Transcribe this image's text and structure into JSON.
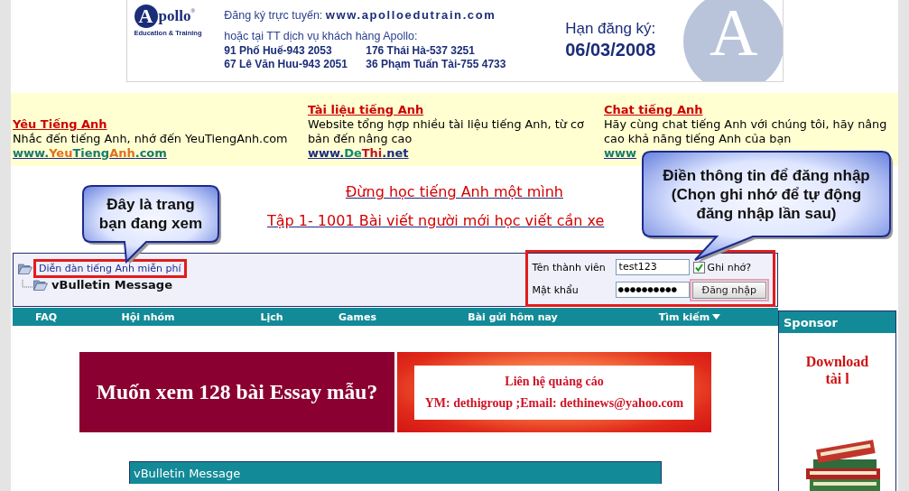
{
  "banner": {
    "logo": {
      "initial": "A",
      "name": "pollo",
      "mark": "®",
      "tagline": "Education & Training"
    },
    "register_label": "Đăng ký trực tuyến:",
    "register_url": "www.apolloedutrain.com",
    "service_line": "hoặc tại TT dịch vụ khách hàng Apollo:",
    "addresses": [
      "91 Phố Huế-943 2053",
      "176 Thái Hà-537 3251",
      "67 Lê Văn Huu-943 2051",
      "36 Phạm Tuấn Tài-755 4733"
    ],
    "deadline_label": "Hạn đăng ký:",
    "deadline_date": "06/03/2008",
    "emblem_letter": "A"
  },
  "promo_links": [
    {
      "title": "Yêu Tiếng Anh",
      "description": "Nhắc đến tiếng Anh, nhớ đến YeuTiengAnh.com",
      "url": [
        {
          "text": "www.",
          "color": "#1a7a68"
        },
        {
          "text": "Yeu",
          "color": "#e0701c"
        },
        {
          "text": "Tieng",
          "color": "#1a7a68"
        },
        {
          "text": "Anh",
          "color": "#e0701c"
        },
        {
          "text": ".com",
          "color": "#1a7a68"
        }
      ]
    },
    {
      "title": "Tài liệu tiếng Anh",
      "description": "Website tổng hợp nhiều tài liệu tiếng Anh, từ cơ bản đến nâng cao",
      "url": [
        {
          "text": "www.",
          "color": "#1c2a80"
        },
        {
          "text": "De",
          "color": "#128a6a"
        },
        {
          "text": "Thi",
          "color": "#c0142a"
        },
        {
          "text": ".net",
          "color": "#1c2a80"
        }
      ]
    },
    {
      "title": "Chat tiếng Anh",
      "description": "Hãy cùng chat tiếng Anh với chúng tôi, hãy nâng cao khả năng tiếng Anh của bạn",
      "url": [
        {
          "text": "www",
          "color": "#1a7a68"
        }
      ]
    }
  ],
  "headings": [
    "Đừng học tiếng Anh một mình",
    "Tập 1- 1001 Bài viết người mới học viết cần xe"
  ],
  "callouts": [
    {
      "lines": [
        "Đây là trang",
        "bạn đang xem"
      ]
    },
    {
      "lines": [
        "Điền thông tin để đăng nhập",
        "(Chọn ghi nhớ để tự động",
        "đăng nhập lần sau)"
      ]
    }
  ],
  "breadcrumb": {
    "parent": "Diễn đàn tiếng Anh miễn phí",
    "highlighted": true,
    "current": "vBulletin Message"
  },
  "login": {
    "highlighted": true,
    "username_label": "Tên thành viên",
    "username": "test123",
    "remember_label": "Ghi nhớ?",
    "remember_checked": true,
    "password_label": "Mật khẩu",
    "password": "●●●●●●●●●●",
    "submit": "Đăng nhập",
    "submit_focused": true
  },
  "navbar": [
    {
      "label": "FAQ",
      "has_menu": false
    },
    {
      "label": "Hội nhóm",
      "has_menu": false
    },
    {
      "label": "Lịch",
      "has_menu": false
    },
    {
      "label": "Games",
      "has_menu": false
    },
    {
      "label": "Bài gửi hôm nay",
      "has_menu": false
    },
    {
      "label": "Tìm kiếm",
      "has_menu": true
    }
  ],
  "ads": [
    {
      "kind": "banner",
      "text": "Muốn xem 128 bài Essay mẫu?"
    },
    {
      "kind": "contact",
      "title": "Liên hệ quảng cáo",
      "text": "YM: dethigroup ;Email: dethinews@yahoo.com"
    }
  ],
  "sponsor": {
    "title": "Sponsor",
    "text": "Download tài l"
  },
  "message_box": {
    "title": "vBulletin Message"
  }
}
